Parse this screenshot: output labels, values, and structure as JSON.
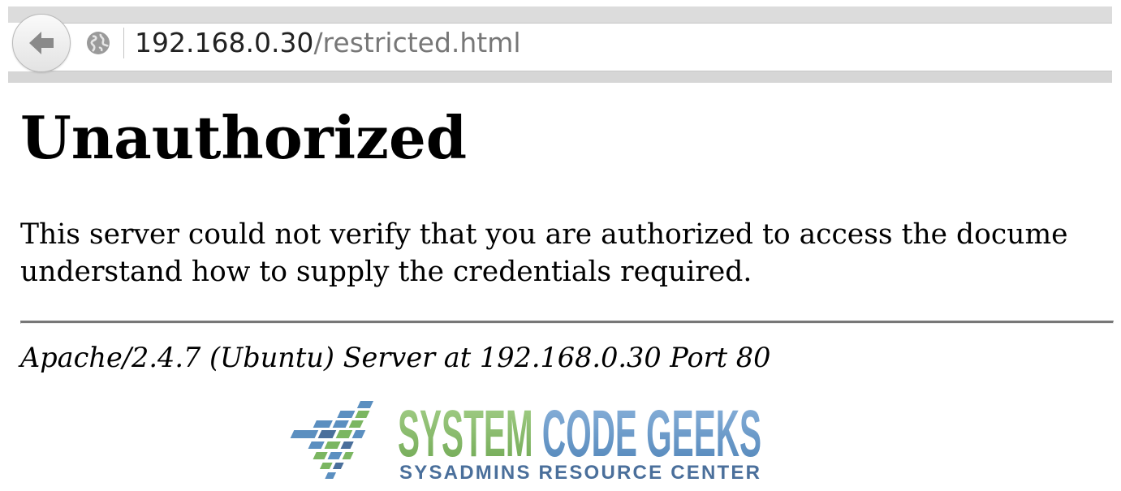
{
  "browser": {
    "url_host": "192.168.0.30",
    "url_path": "/restricted.html",
    "icons": {
      "back": "back-arrow-icon",
      "site": "globe-icon"
    }
  },
  "page": {
    "title": "Unauthorized",
    "message_line_1": "This server could not verify that you are authorized to access the docume",
    "message_line_2": "understand how to supply the credentials required.",
    "signature": "Apache/2.4.7 (Ubuntu) Server at 192.168.0.30 Port 80"
  },
  "logo": {
    "name": "SYSTEM CODE GEEKS",
    "tagline": "SYSADMINS RESOURCE CENTER",
    "colors": {
      "blue": "#5b8fc0",
      "green": "#7bb661",
      "tagline": "#4a6f9b"
    }
  }
}
